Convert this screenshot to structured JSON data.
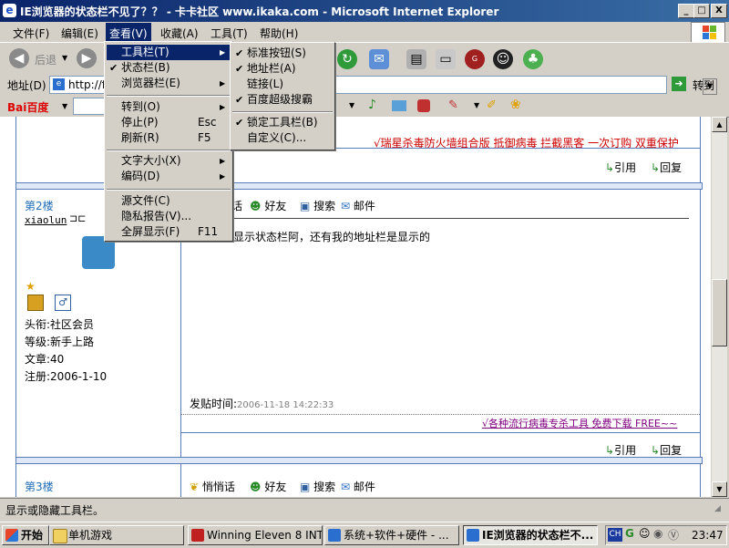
{
  "window": {
    "title": "IE浏览器的状态栏不见了？？ - 卡卡社区 www.ikaka.com - Microsoft Internet Explorer",
    "buttons": {
      "minimize": "_",
      "maximize": "□",
      "close": "X"
    }
  },
  "menubar": {
    "items": [
      "文件(F)",
      "编辑(E)",
      "查看(V)",
      "收藏(A)",
      "工具(T)",
      "帮助(H)"
    ]
  },
  "toolbar": {
    "back_label": "后退"
  },
  "addressbar": {
    "label": "地址(D)",
    "value": "http://fo",
    "go_label": "转到"
  },
  "baidubar": {
    "brand": "Bai百度"
  },
  "view_menu": {
    "items": [
      {
        "label": "工具栏(T)",
        "submenu": true,
        "check": false
      },
      {
        "label": "状态栏(B)",
        "check": true
      },
      {
        "label": "浏览器栏(E)",
        "submenu": true,
        "check": false
      },
      {
        "label": "转到(O)",
        "submenu": true,
        "check": false
      },
      {
        "label": "停止(P)",
        "shortcut": "Esc",
        "check": false
      },
      {
        "label": "刷新(R)",
        "shortcut": "F5",
        "check": false
      },
      {
        "label": "文字大小(X)",
        "submenu": true,
        "check": false
      },
      {
        "label": "编码(D)",
        "submenu": true,
        "check": false
      },
      {
        "label": "源文件(C)",
        "check": false
      },
      {
        "label": "隐私报告(V)...",
        "check": false
      },
      {
        "label": "全屏显示(F)",
        "shortcut": "F11",
        "check": false
      }
    ]
  },
  "toolbars_submenu": {
    "items": [
      {
        "label": "标准按钮(S)",
        "check": true
      },
      {
        "label": "地址栏(A)",
        "check": true
      },
      {
        "label": "链接(L)",
        "check": false
      },
      {
        "label": "百度超级搜霸",
        "check": true
      },
      {
        "label": "锁定工具栏(B)",
        "check": true
      },
      {
        "label": "自定义(C)...",
        "check": false
      }
    ]
  },
  "post1": {
    "ad": "√瑞星杀毒防火墙组合版 抵御病毒 拦截黑客 一次订购 双重保护",
    "quote": "引用",
    "reply": "回复"
  },
  "post2": {
    "floor": "第2楼",
    "username": "xiaolun",
    "actions": [
      "话",
      "好友",
      "搜索",
      "邮件"
    ],
    "body": "显示状态栏阿，还有我的地址栏是显示的",
    "profile": [
      "头衔:社区会员",
      "等级:新手上路",
      "文章:40",
      "注册:2006-1-10"
    ],
    "posted_label": "发贴时间:",
    "posted_time": "2006-11-18 14:22:33",
    "ad": "√各种流行病毒专杀工具 免费下载 FREE~~",
    "quote": "引用",
    "reply": "回复"
  },
  "post3": {
    "floor": "第3楼",
    "actions": [
      "悄悄话",
      "好友",
      "搜索",
      "邮件"
    ]
  },
  "statusbar": {
    "text": "显示或隐藏工具栏。"
  },
  "taskbar": {
    "start": "开始",
    "tasks": [
      "单机游戏",
      "Winning Eleven 8 INTE...",
      "系统+软件+硬件 - ...",
      "IE浏览器的状态栏不..."
    ],
    "ime": "CH",
    "clock": "23:47"
  }
}
